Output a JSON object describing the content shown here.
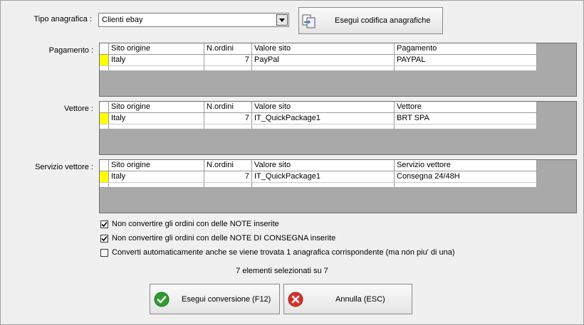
{
  "tipo": {
    "label": "Tipo anagrafica :",
    "value": "Clienti ebay"
  },
  "buttons": {
    "codifica": "Esegui codifica anagrafiche",
    "converti": "Esegui conversione (F12)",
    "annulla": "Annulla (ESC)"
  },
  "sections": [
    {
      "label": "Pagamento :",
      "headers": [
        "Sito origine",
        "N.ordini",
        "Valore sito",
        "Pagamento"
      ],
      "row": [
        "Italy",
        "7",
        "PayPal",
        "PAYPAL"
      ]
    },
    {
      "label": "Vettore :",
      "headers": [
        "Sito origine",
        "N.ordini",
        "Valore sito",
        "Vettore"
      ],
      "row": [
        "Italy",
        "7",
        "IT_QuickPackage1",
        "BRT SPA"
      ]
    },
    {
      "label": "Servizio vettore :",
      "headers": [
        "Sito origine",
        "N.ordini",
        "Valore sito",
        "Servizio vettore"
      ],
      "row": [
        "Italy",
        "7",
        "IT_QuickPackage1",
        "Consegna 24/48H"
      ]
    }
  ],
  "options": [
    {
      "label": "Non convertire gli ordini con delle NOTE inserite",
      "checked": true
    },
    {
      "label": "Non convertire gli ordini con delle NOTE DI CONSEGNA inserite",
      "checked": true
    },
    {
      "label": "Converti automaticamente anche se viene trovata 1 anagrafica corrispondente (ma non piu' di una)",
      "checked": false
    }
  ],
  "status": "7 elementi selezionati su 7",
  "colors": {
    "selector": "#ffff00",
    "grid_bg": "#a9a9a9",
    "ok": "#2e9d2e",
    "cancel": "#d9302a"
  },
  "icons": {
    "combo_arrow": "chevron-down-icon",
    "codifica": "document-convert-icon",
    "converti": "check-icon",
    "annulla": "close-icon"
  }
}
